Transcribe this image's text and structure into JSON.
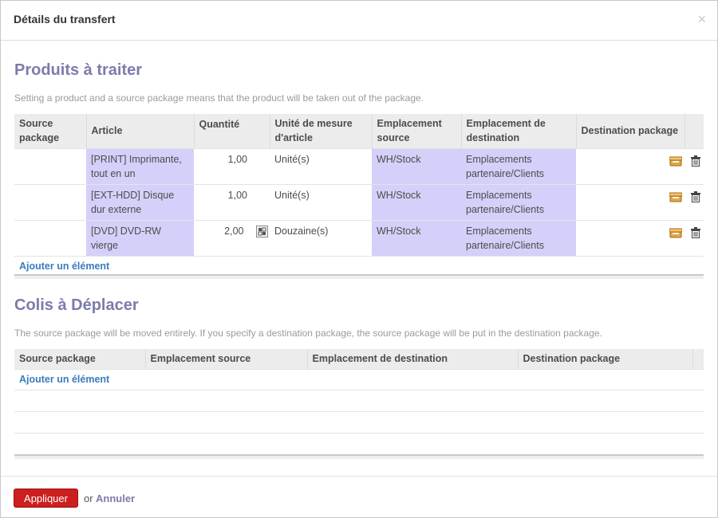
{
  "dialog": {
    "title": "Détails du transfert",
    "close": "×"
  },
  "products": {
    "title": "Produits à traiter",
    "help": "Setting a product and a source package means that the product will be taken out of the package.",
    "columns": [
      "Source package",
      "Article",
      "Quantité",
      "Unité de mesure d'article",
      "Emplacement source",
      "Emplacement de destination",
      "Destination package"
    ],
    "rows": [
      {
        "source_package": "",
        "article": "[PRINT] Imprimante, tout en un",
        "quantity": "1,00",
        "uom": "Unité(s)",
        "source_location": "WH/Stock",
        "dest_location": "Emplacements partenaire/Clients",
        "dest_package": ""
      },
      {
        "source_package": "",
        "article": "[EXT-HDD] Disque dur externe",
        "quantity": "1,00",
        "uom": "Unité(s)",
        "source_location": "WH/Stock",
        "dest_location": "Emplacements partenaire/Clients",
        "dest_package": ""
      },
      {
        "source_package": "",
        "article": "[DVD] DVD-RW vierge",
        "quantity": "2,00",
        "uom": "Douzaine(s)",
        "source_location": "WH/Stock",
        "dest_location": "Emplacements partenaire/Clients",
        "dest_package": ""
      }
    ],
    "add_item": "Ajouter un élément"
  },
  "packages": {
    "title": "Colis à Déplacer",
    "help": "The source package will be moved entirely. If you specify a destination package, the source package will be put in the destination package.",
    "columns": [
      "Source package",
      "Emplacement source",
      "Emplacement de destination",
      "Destination package"
    ],
    "add_item": "Ajouter un élément"
  },
  "footer": {
    "apply": "Appliquer",
    "or": "or",
    "cancel": "Annuler"
  },
  "colors": {
    "accent": "#7c7bad",
    "highlight": "#d4d0f9",
    "apply_button": "#cc1f1f",
    "link": "#3a7cbf"
  },
  "icons": [
    "close-icon",
    "package-icon",
    "trash-icon",
    "pack-quantity-icon"
  ]
}
